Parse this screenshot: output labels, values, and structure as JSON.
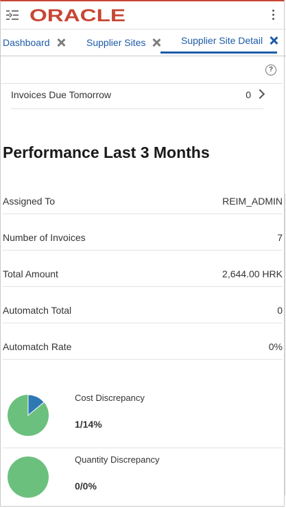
{
  "header": {
    "logo_text": "ORACLE",
    "brand_color": "#c74634"
  },
  "tabs": [
    {
      "label": "Dashboard"
    },
    {
      "label": "Supplier Sites"
    },
    {
      "label": "Supplier Site Detail"
    }
  ],
  "due": {
    "label": "Invoices Due Tomorrow",
    "value": "0"
  },
  "performance": {
    "title": "Performance Last 3 Months",
    "rows": [
      {
        "label": "Assigned To",
        "value": "REIM_ADMIN"
      },
      {
        "label": "Number of Invoices",
        "value": "7"
      },
      {
        "label": "Total Amount",
        "value": "2,644.00 HRK"
      },
      {
        "label": "Automatch Total",
        "value": "0"
      },
      {
        "label": "Automatch Rate",
        "value": "0%"
      }
    ]
  },
  "discrepancies": [
    {
      "title": "Cost Discrepancy",
      "value": "1/14%",
      "fraction": 0.14
    },
    {
      "title": "Quantity Discrepancy",
      "value": "0/0%",
      "fraction": 0
    }
  ],
  "colors": {
    "accent": "#1c5ba8",
    "pie_main": "#6cc07d",
    "pie_slice": "#2e78b4"
  }
}
